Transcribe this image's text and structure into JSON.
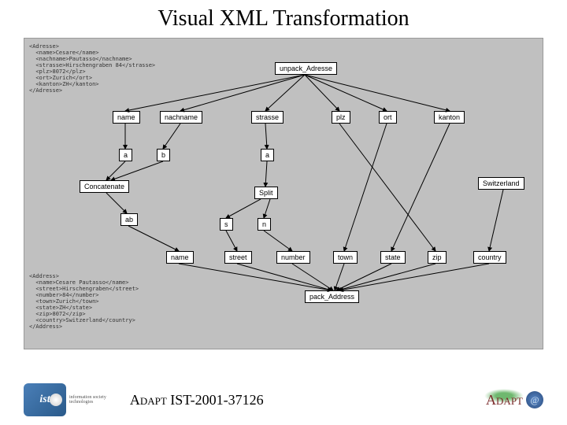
{
  "title": "Visual XML Transformation",
  "footer": {
    "project_code": "Adapt IST-2001-37126",
    "brand": "Adapt",
    "ist_mark": "ist"
  },
  "xml_top": "<Adresse>\n  <name>Cesare</name>\n  <nachname>Pautasso</nachname>\n  <strasse>Hirschengraben 84</strasse>\n  <plz>8072</plz>\n  <ort>Zurich</ort>\n  <kanton>ZH</kanton>\n</Adresse>",
  "xml_bottom": "<Address>\n  <name>Cesare Pautasso</name>\n  <street>Hirschengraben</street>\n  <number>84</number>\n  <town>Zurich</town>\n  <state>ZH</state>\n  <zip>8072</zip>\n  <country>Switzerland</country>\n</Address>",
  "nodes": {
    "unpack": "unpack_Adresse",
    "name": "name",
    "nachname": "nachname",
    "strasse": "strasse",
    "plz": "plz",
    "ort": "ort",
    "kanton": "kanton",
    "a": "a",
    "b": "b",
    "a2": "a",
    "concat": "Concatenate",
    "split": "Split",
    "switz": "Switzerland",
    "ab": "ab",
    "s": "s",
    "n": "n",
    "name2": "name",
    "street": "street",
    "number": "number",
    "town": "town",
    "state": "state",
    "zip": "zip",
    "country": "country",
    "pack": "pack_Address"
  }
}
